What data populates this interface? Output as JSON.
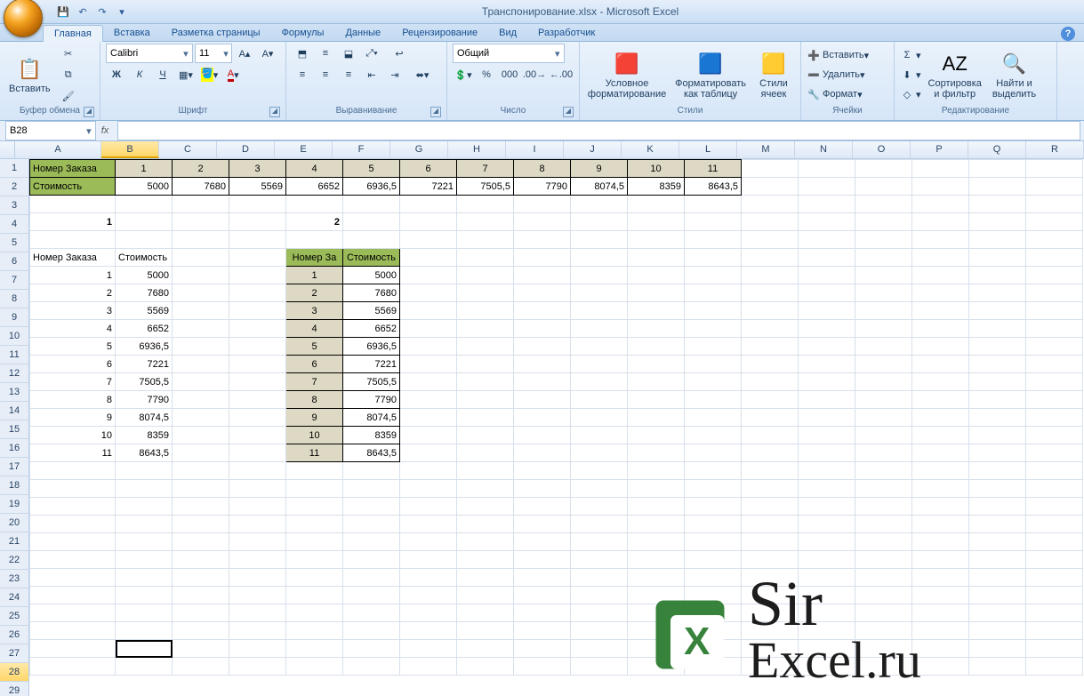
{
  "app": {
    "title": "Транспонирование.xlsx - Microsoft Excel"
  },
  "qat": {
    "save": "💾",
    "undo": "↶",
    "redo": "↷",
    "more": "▾"
  },
  "tabs": {
    "items": [
      "Главная",
      "Вставка",
      "Разметка страницы",
      "Формулы",
      "Данные",
      "Рецензирование",
      "Вид",
      "Разработчик"
    ],
    "active": 0
  },
  "ribbon": {
    "clipboard": {
      "paste": "Вставить",
      "label": "Буфер обмена"
    },
    "font": {
      "name": "Calibri",
      "size": "11",
      "label": "Шрифт",
      "bold": "Ж",
      "italic": "К",
      "underline": "Ч"
    },
    "align": {
      "label": "Выравнивание",
      "wrap": ""
    },
    "number": {
      "format": "Общий",
      "label": "Число"
    },
    "styles": {
      "cond": "Условное\nформатирование",
      "table": "Форматировать\nкак таблицу",
      "cell": "Стили\nячеек",
      "label": "Стили"
    },
    "cells": {
      "insert": "Вставить",
      "delete": "Удалить",
      "format": "Формат",
      "label": "Ячейки"
    },
    "editing": {
      "sort": "Сортировка\nи фильтр",
      "find": "Найти и\nвыделить",
      "label": "Редактирование"
    }
  },
  "formulabar": {
    "name": "B28",
    "fx": "fx",
    "value": ""
  },
  "columns": [
    "A",
    "B",
    "C",
    "D",
    "E",
    "F",
    "G",
    "H",
    "I",
    "J",
    "K",
    "L",
    "M",
    "N",
    "O",
    "P",
    "Q",
    "R"
  ],
  "activeCol": 1,
  "activeRow": 28,
  "rows": 29,
  "sheet": {
    "r1": {
      "A": "Номер Заказа",
      "nums": [
        "1",
        "2",
        "3",
        "4",
        "5",
        "6",
        "7",
        "8",
        "9",
        "10",
        "11"
      ]
    },
    "r2": {
      "A": "Стоимость",
      "vals": [
        "5000",
        "7680",
        "5569",
        "6652",
        "6936,5",
        "7221",
        "7505,5",
        "7790",
        "8074,5",
        "8359",
        "8643,5"
      ]
    },
    "r4": {
      "A": "1",
      "E": "2"
    },
    "r6": {
      "A": "Номер Заказа",
      "B": "Стоимость",
      "E": "Номер За",
      "F": "Стоимость"
    },
    "list": [
      {
        "n": "1",
        "v": "5000"
      },
      {
        "n": "2",
        "v": "7680"
      },
      {
        "n": "3",
        "v": "5569"
      },
      {
        "n": "4",
        "v": "6652"
      },
      {
        "n": "5",
        "v": "6936,5"
      },
      {
        "n": "6",
        "v": "7221"
      },
      {
        "n": "7",
        "v": "7505,5"
      },
      {
        "n": "8",
        "v": "7790"
      },
      {
        "n": "9",
        "v": "8074,5"
      },
      {
        "n": "10",
        "v": "8359"
      },
      {
        "n": "11",
        "v": "8643,5"
      }
    ]
  },
  "watermark": {
    "line1": "Sir",
    "line2": "Excel.ru"
  }
}
